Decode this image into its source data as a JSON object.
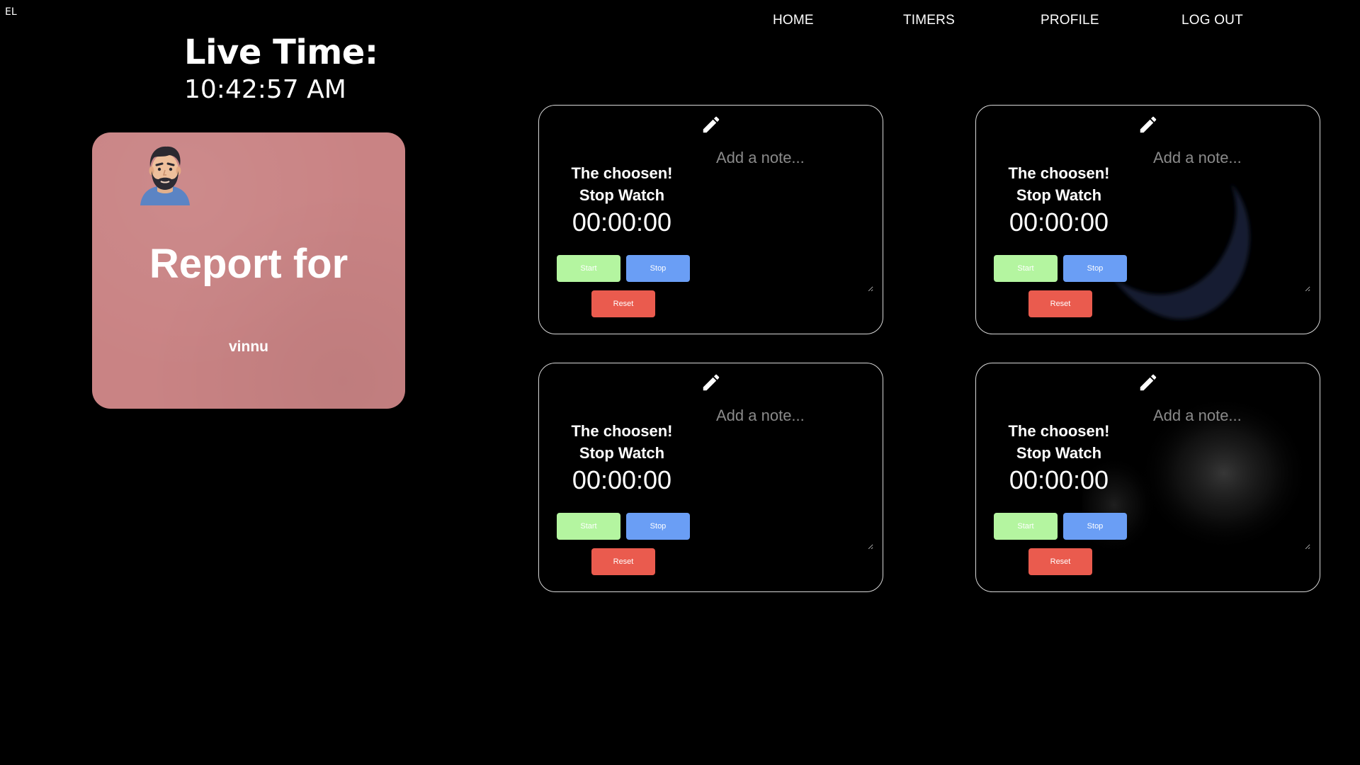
{
  "brand": {
    "logo_text": "EL"
  },
  "nav": {
    "items": [
      {
        "label": "HOME"
      },
      {
        "label": "TIMERS"
      },
      {
        "label": "PROFILE"
      },
      {
        "label": "LOG OUT"
      }
    ]
  },
  "live": {
    "title": "Live Time:",
    "time": "10:42:57 AM"
  },
  "report": {
    "title": "Report for",
    "user": "vinnu",
    "card_color": "#c98384",
    "avatar_icon": "bearded-man-avatar"
  },
  "timers": [
    {
      "title_line1": "The choosen!",
      "title_line2": "Stop Watch",
      "time": "00:00:00",
      "note_placeholder": "Add a note...",
      "start_label": "Start",
      "stop_label": "Stop",
      "reset_label": "Reset"
    },
    {
      "title_line1": "The choosen!",
      "title_line2": "Stop Watch",
      "time": "00:00:00",
      "note_placeholder": "Add a note...",
      "start_label": "Start",
      "stop_label": "Stop",
      "reset_label": "Reset"
    },
    {
      "title_line1": "The choosen!",
      "title_line2": "Stop Watch",
      "time": "00:00:00",
      "note_placeholder": "Add a note...",
      "start_label": "Start",
      "stop_label": "Stop",
      "reset_label": "Reset"
    },
    {
      "title_line1": "The choosen!",
      "title_line2": "Stop Watch",
      "time": "00:00:00",
      "note_placeholder": "Add a note...",
      "start_label": "Start",
      "stop_label": "Stop",
      "reset_label": "Reset"
    }
  ],
  "colors": {
    "start": "#b4f5a0",
    "stop": "#6a9ef5",
    "reset": "#ea5b4e",
    "card_border": "#d8d8d8"
  },
  "icons": {
    "edit": "pencil-icon"
  }
}
